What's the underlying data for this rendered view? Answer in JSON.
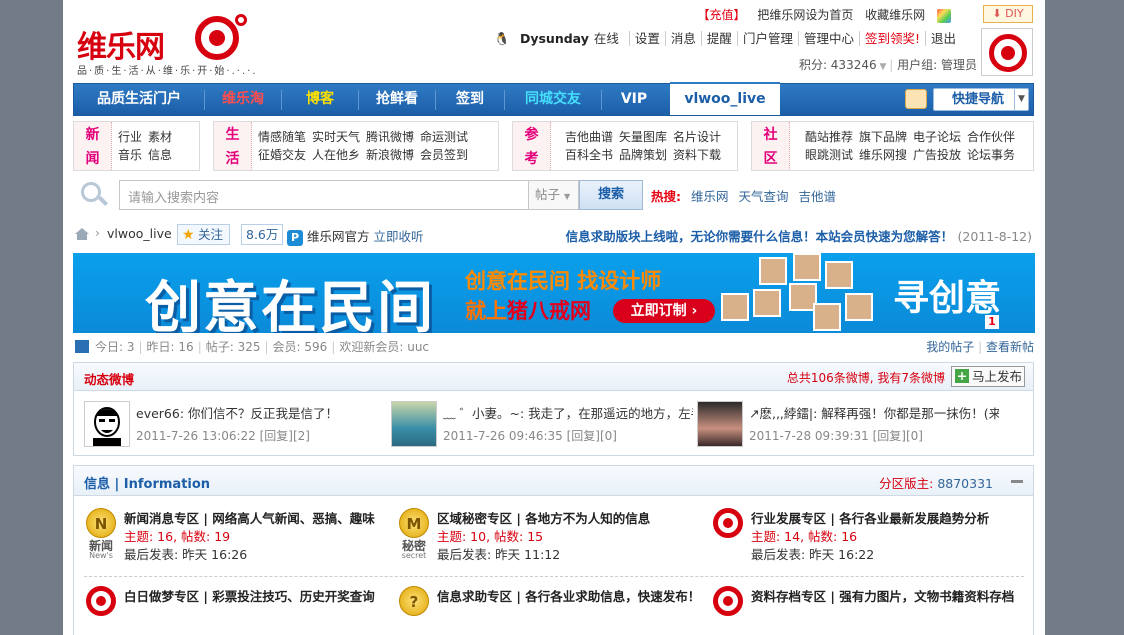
{
  "header": {
    "logo_name": "维乐网",
    "logo_slogan": "品·质·生·活·从·维·乐·开·始·.·.·.",
    "top_links": [
      "【充值】",
      "把维乐网设为首页",
      "收藏维乐网"
    ],
    "diy": "DIY",
    "user": {
      "name": "Dysunday",
      "status": "在线",
      "links": [
        "设置",
        "消息",
        "提醒",
        "门户管理",
        "管理中心",
        "签到领奖!",
        "退出"
      ],
      "points": "积分: 433246",
      "group": "用户组: 管理员"
    }
  },
  "nav": {
    "items": [
      "品质生活门户",
      "维乐淘",
      "博客",
      "抢鲜看",
      "签到",
      "同城交友",
      "VIP",
      "vlwoo_live"
    ],
    "colors": [
      "#ffffff",
      "#ff4d4d",
      "#ffe000",
      "#ffffff",
      "#ffffff",
      "#46e0ff",
      "#ffffff",
      "#1c5ea8"
    ],
    "quick_nav": "快捷导航"
  },
  "categories": [
    {
      "label1": "新",
      "label2": "闻",
      "row1": [
        "行业",
        "素材"
      ],
      "row2": [
        "音乐",
        "信息"
      ]
    },
    {
      "label1": "生",
      "label2": "活",
      "row1": [
        "情感随笔",
        "实时天气",
        "腾讯微博",
        "命运测试"
      ],
      "row2": [
        "征婚交友",
        "人在他乡",
        "新浪微博",
        "会员签到"
      ]
    },
    {
      "label1": "参",
      "label2": "考",
      "row1": [
        "吉他曲谱",
        "矢量图库",
        "名片设计"
      ],
      "row2": [
        "百科全书",
        "品牌策划",
        "资料下载"
      ]
    },
    {
      "label1": "社",
      "label2": "区",
      "row1": [
        "酷站推荐",
        "旗下品牌",
        "电子论坛",
        "合作伙伴"
      ],
      "row2": [
        "眼跳测试",
        "维乐网搜",
        "广告投放",
        "论坛事务"
      ]
    }
  ],
  "search": {
    "placeholder": "请输入搜索内容",
    "scope": "帖子",
    "button": "搜索",
    "hot_label": "热搜:",
    "hot": [
      "维乐网",
      "天气查询",
      "吉他谱"
    ]
  },
  "breadcrumb": {
    "current": "vlwoo_live",
    "follow": "关注",
    "follow_count": "8.6万",
    "official": "维乐网官方",
    "collect": "立即收听",
    "notice": "信息求助版块上线啦，无论你需要什么信息！本站会员快速为您解答！",
    "notice_date": "(2011-8-12)"
  },
  "banner": {
    "big": "创意在民间",
    "line1": "创意在民间  找设计师",
    "line2a": "就上",
    "line2b": "猪八戒网",
    "order": "立即订制 ›",
    "seek": "寻创意",
    "page": "1"
  },
  "stats": {
    "today": "今日: 3",
    "yesterday": "昨日: 16",
    "posts": "帖子: 325",
    "members": "会员: 596",
    "welcome": "欢迎新会员: uuc",
    "my_posts": "我的帖子",
    "view_new": "查看新帖"
  },
  "weibo": {
    "title": "动态微博",
    "summary": "总共106条微博, 我有7条微博",
    "publish": "马上发布",
    "posts": [
      {
        "text": "ever66: 你们信不？反正我是信了！",
        "meta": "2011-7-26 13:06:22 [回复][2]"
      },
      {
        "text": "﹏ ゛小妻。~: 我走了，在那遥远的地方，左手",
        "meta": "2011-7-26 09:46:35 [回复][0]"
      },
      {
        "text": "↗麽,,,綍鐳|: 解释再强！你都是那一抹伤！(来",
        "meta": "2011-7-28 09:39:31 [回复][0]"
      }
    ]
  },
  "info": {
    "title": "信息 | Information",
    "moderator_label": "分区版主:",
    "moderator": "8870331",
    "forums": [
      {
        "icon": "news-coin",
        "coin": "N",
        "label": "新闻",
        "sub": "New's",
        "name": "新闻消息专区 | 网络高人气新闻、恶搞、趣味",
        "stats": "主题: 16, 帖数: 19",
        "last": "最后发表: 昨天 16:26"
      },
      {
        "icon": "secret-coin",
        "coin": "M",
        "label": "秘密",
        "sub": "secret",
        "name": "区域秘密专区 | 各地方不为人知的信息",
        "stats": "主题: 10, 帖数: 15",
        "last": "最后发表: 昨天 11:12"
      },
      {
        "icon": "target",
        "name": "行业发展专区 | 各行各业最新发展趋势分析",
        "stats": "主题: 14, 帖数: 16",
        "last": "最后发表: 昨天 16:22"
      },
      {
        "icon": "target",
        "name": "白日做梦专区 | 彩票投注技巧、历史开奖查询"
      },
      {
        "icon": "question-coin",
        "coin": "?",
        "name": "信息求助专区 | 各行各业求助信息，快速发布！"
      },
      {
        "icon": "target",
        "name": "资料存档专区 | 强有力图片，文物书籍资料存档"
      }
    ]
  }
}
